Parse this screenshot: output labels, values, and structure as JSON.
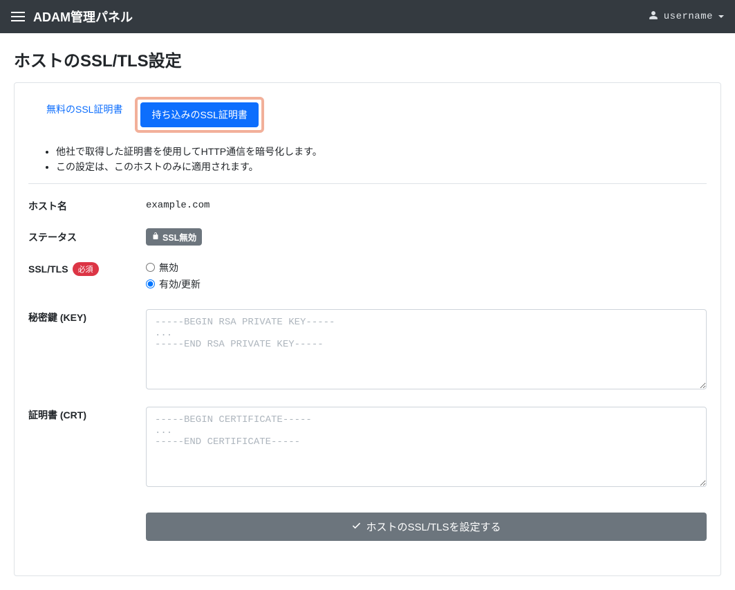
{
  "header": {
    "brand": "ADAM管理パネル",
    "username": "username"
  },
  "page": {
    "title": "ホストのSSL/TLS設定"
  },
  "tabs": {
    "free": "無料のSSL証明書",
    "own": "持ち込みのSSL証明書"
  },
  "description": {
    "items": [
      "他社で取得した証明書を使用してHTTP通信を暗号化します。",
      "この設定は、このホストのみに適用されます。"
    ]
  },
  "form": {
    "host_label": "ホスト名",
    "host_value": "example.com",
    "status_label": "ステータス",
    "status_badge": "SSL無効",
    "ssl_label": "SSL/TLS",
    "required_badge": "必須",
    "radio_disable": "無効",
    "radio_enable": "有効/更新",
    "radio_selected": "enable",
    "key_label": "秘密鍵 (KEY)",
    "key_placeholder": "-----BEGIN RSA PRIVATE KEY-----\n...\n-----END RSA PRIVATE KEY-----",
    "key_value": "",
    "cert_label": "証明書 (CRT)",
    "cert_placeholder": "-----BEGIN CERTIFICATE-----\n...\n-----END CERTIFICATE-----",
    "cert_value": "",
    "submit_label": "ホストのSSL/TLSを設定する"
  }
}
